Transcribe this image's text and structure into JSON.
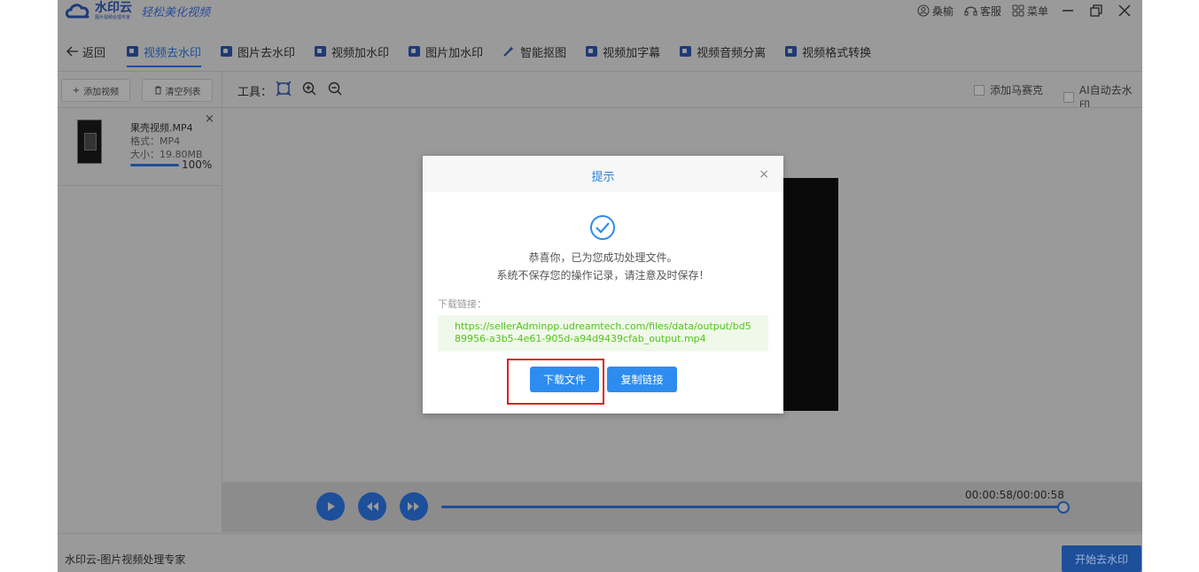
{
  "app": {
    "name": "水印云",
    "sub": "图片视频处理专家",
    "slogan": "轻松美化视频",
    "user": "桑榆",
    "support": "客服",
    "menu": "菜单"
  },
  "nav": {
    "back": "返回",
    "items": [
      {
        "label": "视频去水印",
        "active": true
      },
      {
        "label": "图片去水印"
      },
      {
        "label": "视频加水印"
      },
      {
        "label": "图片加水印"
      },
      {
        "label": "智能抠图"
      },
      {
        "label": "视频加字幕"
      },
      {
        "label": "视频音频分离"
      },
      {
        "label": "视频格式转换"
      }
    ]
  },
  "sidebar": {
    "add_label": "添加视频",
    "clear_label": "清空列表",
    "file": {
      "name": "果壳视频.MP4",
      "format": "格式：MP4",
      "size": "大小：19.80MB",
      "progress": "100%",
      "progress_value": 1.0
    }
  },
  "toolbar": {
    "tools_label": "工具：",
    "mosaic_label": "添加马赛克",
    "ai_label": "AI自动去水印"
  },
  "player": {
    "timecode": "00:00:58/00:00:58",
    "progress_value": 1.0
  },
  "status": {
    "text": "水印云-图片视频处理专家",
    "start_label": "开始去水印"
  },
  "dialog": {
    "title": "提示",
    "message1": "恭喜你，已为您成功处理文件。",
    "message2": "系统不保存您的操作记录，请注意及时保存！",
    "download_label": "下载链接：",
    "link": "https://sellerAdminpp.udreamtech.com/files/data/output/bd589956-a3b5-4e61-905d-a94d9439cfab_output.mp4",
    "download_button": "下载文件",
    "copy_button": "复制链接"
  }
}
